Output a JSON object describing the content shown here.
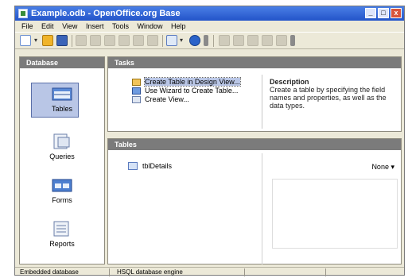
{
  "window": {
    "title": "Example.odb - OpenOffice.org Base",
    "btn_min": "_",
    "btn_max": "□",
    "btn_close": "x"
  },
  "menu": [
    "File",
    "Edit",
    "View",
    "Insert",
    "Tools",
    "Window",
    "Help"
  ],
  "database_pane": {
    "header": "Database",
    "items": [
      {
        "label": "Tables",
        "selected": true
      },
      {
        "label": "Queries",
        "selected": false
      },
      {
        "label": "Forms",
        "selected": false
      },
      {
        "label": "Reports",
        "selected": false
      }
    ]
  },
  "tasks_pane": {
    "header": "Tasks",
    "items": [
      "Create Table in Design View...",
      "Use Wizard to Create Table...",
      "Create View..."
    ],
    "description_title": "Description",
    "description_text": "Create a table by specifying the field names and properties, as well as the data types."
  },
  "tables_pane": {
    "header": "Tables",
    "items": [
      "tblDetails"
    ],
    "preview_select": "None"
  },
  "status": {
    "left": "Embedded database",
    "right": "HSQL database engine"
  },
  "colors": {
    "titlebar": "#2354c9",
    "pane_header": "#7b7b7b",
    "selection": "#b9c6e6"
  }
}
